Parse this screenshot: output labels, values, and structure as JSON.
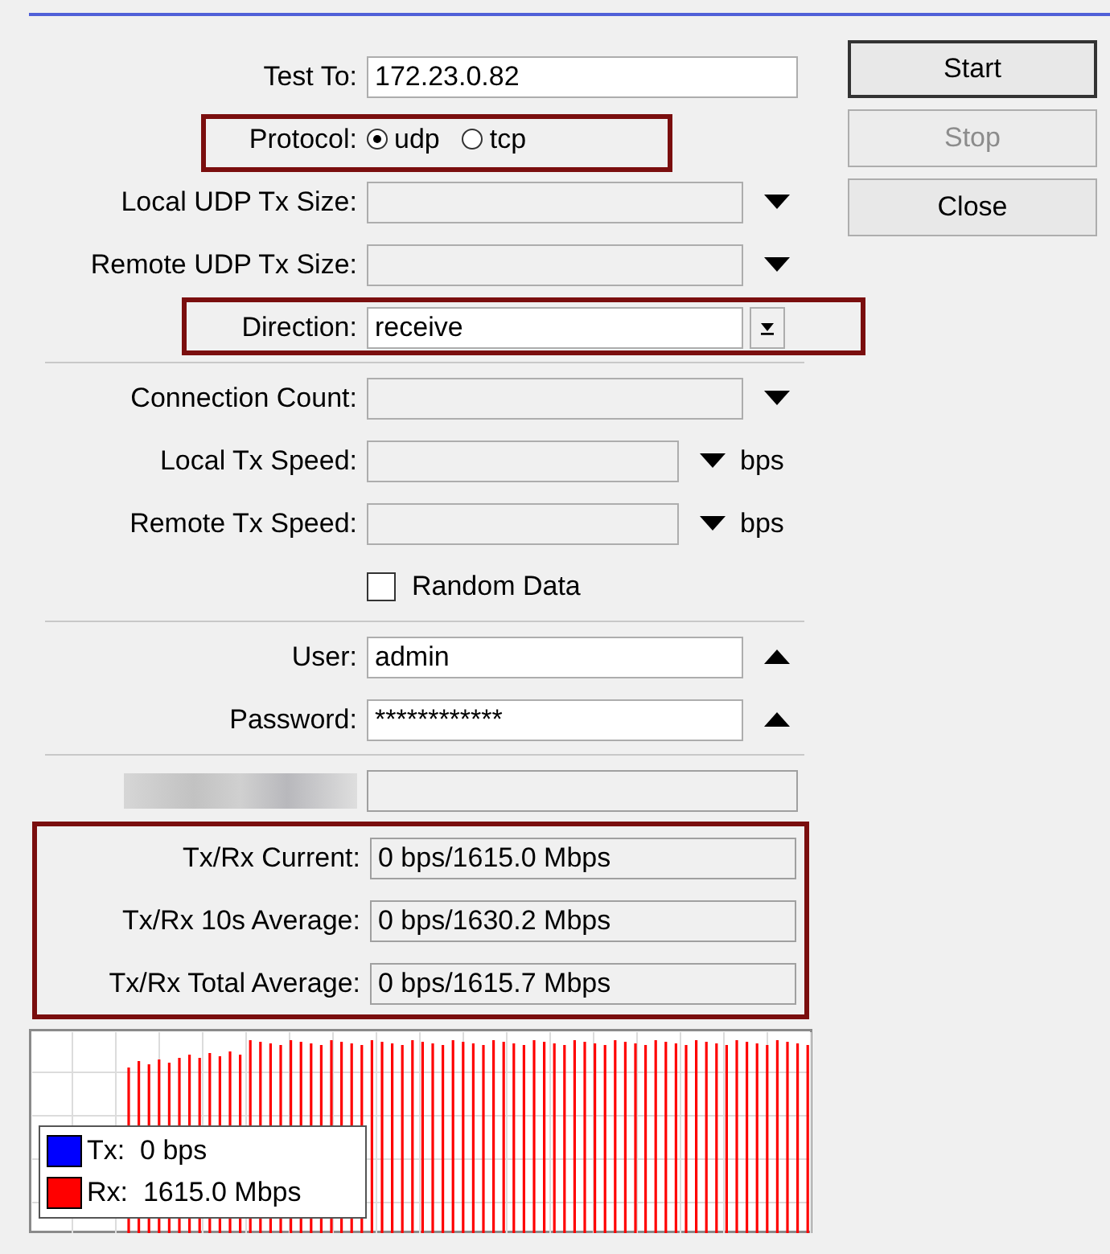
{
  "sections": [
    {
      "rows": [
        {
          "kind": "text",
          "label": "Test To:",
          "value": "172.23.0.82"
        },
        {
          "kind": "radio",
          "label": "Protocol:",
          "highlighted": true,
          "options": [
            {
              "label": "udp",
              "selected": true
            },
            {
              "label": "tcp",
              "selected": false
            }
          ]
        },
        {
          "kind": "combo",
          "label": "Local UDP Tx Size:",
          "arrow": {
            "kind": "down"
          }
        },
        {
          "kind": "combo",
          "label": "Remote UDP Tx Size:",
          "arrow": {
            "kind": "down"
          }
        },
        {
          "kind": "combo",
          "label": "Direction:",
          "value": "receive",
          "arrow": {
            "kind": "drop"
          },
          "highlighted": true
        }
      ]
    },
    {
      "rows": [
        {
          "kind": "combo",
          "label": "Connection Count:",
          "arrow": {
            "kind": "down"
          }
        },
        {
          "kind": "combo",
          "label": "Local Tx Speed:",
          "arrow": {
            "kind": "down"
          },
          "unit": "bps"
        },
        {
          "kind": "combo",
          "label": "Remote Tx Speed:",
          "arrow": {
            "kind": "down"
          },
          "unit": "bps"
        },
        {
          "kind": "checkbox",
          "label": "Random Data",
          "checked": false
        }
      ]
    },
    {
      "rows": [
        {
          "kind": "text",
          "label": "User:",
          "value": "admin",
          "arrow": {
            "kind": "up"
          }
        },
        {
          "kind": "text",
          "label": "Password:",
          "value": "************",
          "arrow": {
            "kind": "up"
          }
        }
      ]
    },
    {
      "rows": [
        {
          "kind": "readonly",
          "redacted": true
        }
      ]
    },
    {
      "highlighted": true,
      "rows": [
        {
          "kind": "readonly",
          "label": "Tx/Rx Current:",
          "value": "0 bps/1615.0 Mbps"
        },
        {
          "kind": "readonly",
          "label": "Tx/Rx 10s Average:",
          "value": "0 bps/1630.2 Mbps"
        },
        {
          "kind": "readonly",
          "label": "Tx/Rx Total Average:",
          "value": "0 bps/1615.7 Mbps"
        }
      ]
    }
  ],
  "buttons": [
    {
      "label": "Start",
      "default": true,
      "disabled": false
    },
    {
      "label": "Stop",
      "default": false,
      "disabled": true
    },
    {
      "label": "Close",
      "default": false,
      "disabled": false
    }
  ],
  "legend": [
    {
      "label": "Tx:  0 bps",
      "color": "#0000ff"
    },
    {
      "label": "Rx:  1615.0 Mbps",
      "color": "#ff0000"
    }
  ]
}
